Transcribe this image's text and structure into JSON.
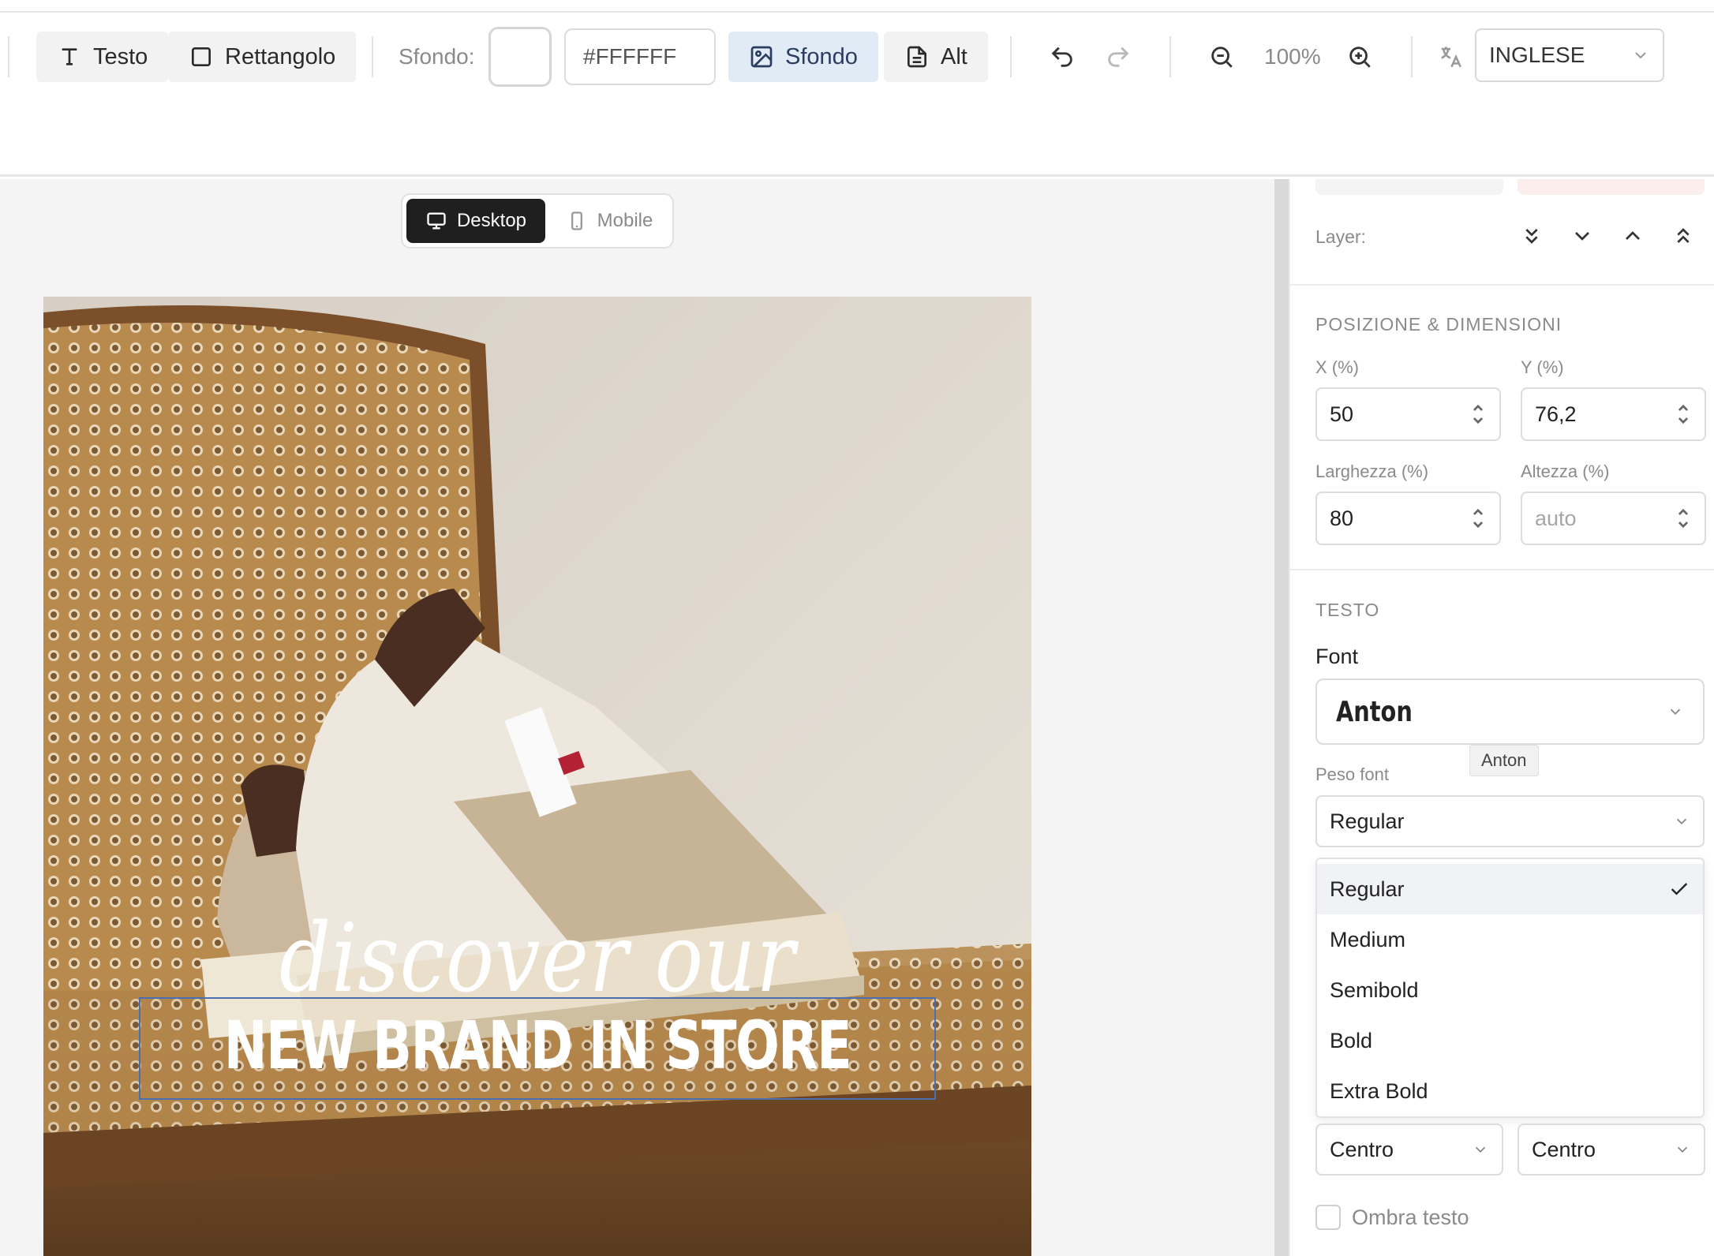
{
  "toolbar": {
    "text_tool": "Testo",
    "rect_tool": "Rettangolo",
    "background_label": "Sfondo:",
    "background_hex": "#FFFFFF",
    "background_image_btn": "Sfondo",
    "alt_btn": "Alt",
    "zoom": "100%",
    "language": "INGLESE"
  },
  "view_toggle": {
    "desktop": "Desktop",
    "mobile": "Mobile",
    "active": "Desktop"
  },
  "canvas": {
    "script_line": "discover our",
    "bold_line": "NEW BRAND IN STORE"
  },
  "panel": {
    "layer_label": "Layer:",
    "position_section": "POSIZIONE & DIMENSIONI",
    "x_label": "X (%)",
    "x_value": "50",
    "y_label": "Y (%)",
    "y_value": "76,2",
    "width_label": "Larghezza (%)",
    "width_value": "80",
    "height_label": "Altezza (%)",
    "height_placeholder": "auto",
    "text_section": "TESTO",
    "font_label": "Font",
    "font_value": "Anton",
    "font_tooltip": "Anton",
    "weight_label": "Peso font",
    "weight_value": "Regular",
    "weight_options": [
      "Regular",
      "Medium",
      "Semibold",
      "Bold",
      "Extra Bold"
    ],
    "h_align": "Centro",
    "v_align": "Centro",
    "shadow_label": "Ombra testo"
  },
  "colors": {
    "active_tab_bg": "#e1ebf6",
    "selection_border": "#4a6fb0",
    "dark_toggle": "#1f1f1f"
  }
}
